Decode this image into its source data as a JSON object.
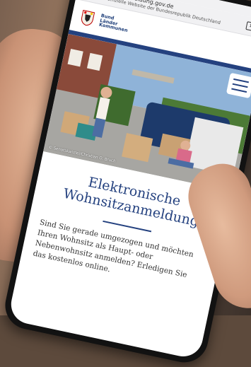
{
  "browser": {
    "url": "wohnsitzanmeldung.gov.de",
    "verified_text": "Eine offizielle Website der Bundesrepublik Deutschland",
    "tab_count": "1",
    "icons": [
      "germany-flag-icon",
      "tabs-icon",
      "more-menu-icon"
    ]
  },
  "site": {
    "logo_lines": [
      "Bund",
      "Länder",
      "Kommunen"
    ],
    "menu_icon": "hamburger-menu-icon"
  },
  "hero": {
    "credit": "© Senatskanzlei/Christian O. Bruch"
  },
  "main": {
    "title_line1": "Elektronische",
    "title_line2": "Wohnsitzanmeldung",
    "intro_lines": [
      "Sind Sie gerade umgezogen und möchten",
      "Ihren Wohnsitz als Haupt- oder",
      "Nebenwohnsitz anmelden? Erledigen Sie",
      "das kostenlos online."
    ]
  },
  "colors": {
    "brand_blue": "#24417f",
    "page_bg": "#ffffff"
  }
}
